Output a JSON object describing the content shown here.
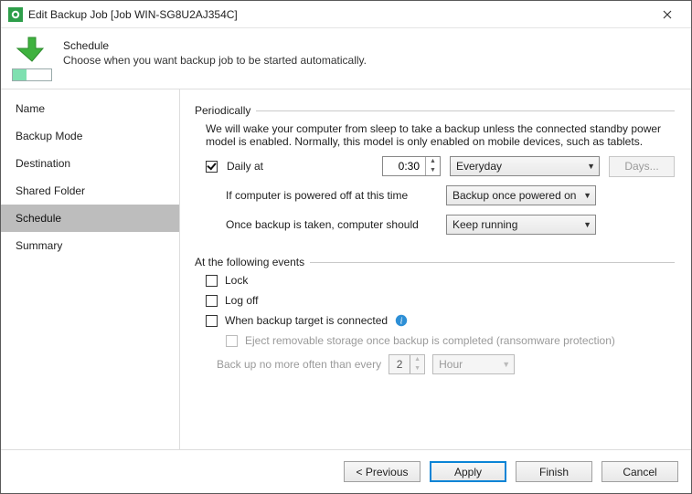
{
  "window": {
    "title": "Edit Backup Job [Job WIN-SG8U2AJ354C]"
  },
  "header": {
    "title": "Schedule",
    "subtitle": "Choose when you want backup job to be started automatically."
  },
  "sidebar": {
    "items": [
      {
        "label": "Name"
      },
      {
        "label": "Backup Mode"
      },
      {
        "label": "Destination"
      },
      {
        "label": "Shared Folder"
      },
      {
        "label": "Schedule",
        "selected": true
      },
      {
        "label": "Summary"
      }
    ]
  },
  "periodic": {
    "legend": "Periodically",
    "description": "We will wake your computer from sleep to take a backup unless the connected standby power model is enabled. Normally, this model is only enabled on mobile devices, such as tablets.",
    "daily_label": "Daily at",
    "daily_time": "0:30",
    "daily_recurrence": "Everyday",
    "days_button": "Days...",
    "powered_off_label": "If computer is powered off at this time",
    "powered_off_value": "Backup once powered on",
    "after_backup_label": "Once backup is taken, computer should",
    "after_backup_value": "Keep running"
  },
  "events": {
    "legend": "At the following events",
    "lock": "Lock",
    "logoff": "Log off",
    "target_connected": "When backup target is connected",
    "eject": "Eject removable storage once backup is completed (ransomware protection)",
    "throttle_prefix": "Back up no more often than every",
    "throttle_value": "2",
    "throttle_unit": "Hour"
  },
  "footer": {
    "previous": "< Previous",
    "apply": "Apply",
    "finish": "Finish",
    "cancel": "Cancel"
  }
}
